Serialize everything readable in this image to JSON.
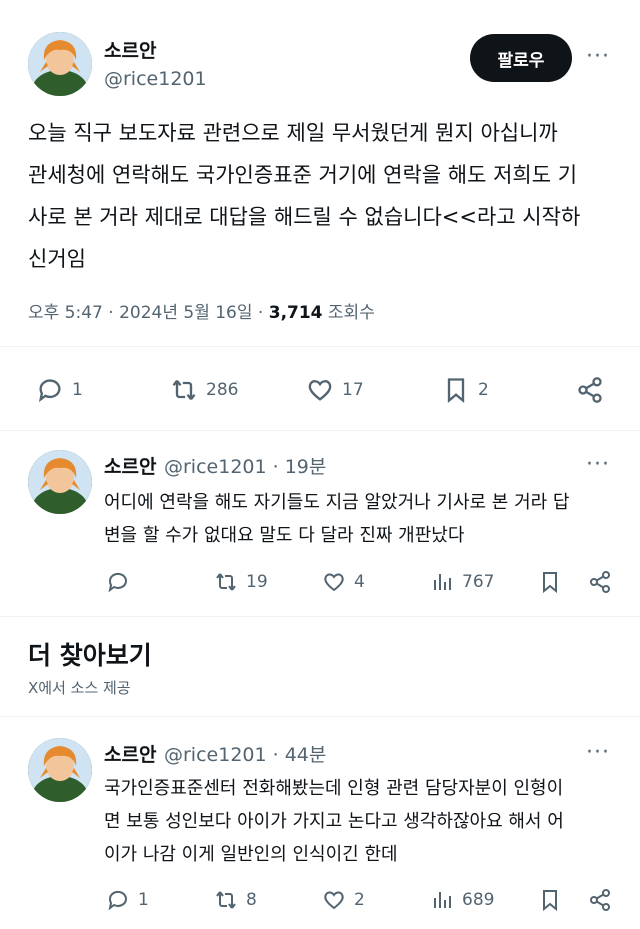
{
  "main_post": {
    "author_name": "소르안",
    "handle": "@rice1201",
    "follow_label": "팔로우",
    "more": "···",
    "text_lines": [
      "오늘 직구 보도자료 관련으로 제일 무서웠던게 뭔지 아십니까",
      "관세청에 연락해도 국가인증표준 거기에 연락을 해도 저희도 기",
      "사로 본 거라 제대로 대답을 해드릴 수 없습니다<<라고 시작하",
      "신거임"
    ],
    "time": "오후 5:47 · 2024년 5월 16일 · ",
    "views_count": "3,714",
    "views_label": " 조회수",
    "replies": "1",
    "reposts": "286",
    "likes": "17",
    "bookmarks": "2",
    "icons": [
      "reply-icon",
      "repost-icon",
      "like-icon",
      "bookmark-icon",
      "share-icon"
    ]
  },
  "reply_1": {
    "author_name": "소르안",
    "handle_time": "@rice1201 · 19분",
    "more": "···",
    "text_lines": [
      "어디에 연락을 해도 자기들도 지금 알았거나 기사로 본 거라 답",
      "변을 할 수가 없대요 말도 다 달라 진짜 개판났다"
    ],
    "replies": "",
    "reposts": "19",
    "likes": "4",
    "views": "767"
  },
  "more_section": {
    "title": "더 찾아보기",
    "subtitle": "X에서 소스 제공"
  },
  "reply_2": {
    "author_name": "소르안",
    "handle_time": "@rice1201 · 44분",
    "more": "···",
    "text_lines": [
      "국가인증표준센터 전화해봤는데 인형 관련 담당자분이 인형이",
      "면 보통 성인보다 아이가 가지고 논다고 생각하잖아요 해서 어",
      "이가 나감 이게 일반인의 인식이긴 한데"
    ],
    "replies": "1",
    "reposts": "8",
    "likes": "2",
    "views": "689"
  }
}
